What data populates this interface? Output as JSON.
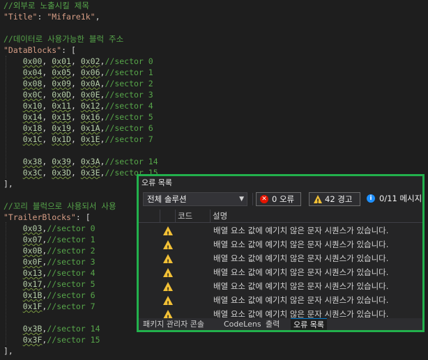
{
  "editor": {
    "lines": [
      {
        "parts": [
          {
            "t": "//외부로 노출시킬 제목",
            "c": "cm"
          }
        ]
      },
      {
        "parts": [
          {
            "t": "\"Title\"",
            "c": "str"
          },
          {
            "t": ": ",
            "c": "pn"
          },
          {
            "t": "\"Mifare1k\"",
            "c": "str"
          },
          {
            "t": ",",
            "c": "pn"
          }
        ]
      },
      {
        "parts": []
      },
      {
        "parts": [
          {
            "t": "//데이터로 사용가능한 블럭 주소",
            "c": "cm"
          }
        ]
      },
      {
        "parts": [
          {
            "t": "\"DataBlocks\"",
            "c": "str"
          },
          {
            "t": ": [",
            "c": "pn"
          }
        ]
      },
      {
        "parts": [
          {
            "t": "    ",
            "c": "pn"
          },
          {
            "t": "0x00",
            "c": "num"
          },
          {
            "t": ", ",
            "c": "pn"
          },
          {
            "t": "0x01",
            "c": "num"
          },
          {
            "t": ", ",
            "c": "pn"
          },
          {
            "t": "0x02",
            "c": "num"
          },
          {
            "t": ",",
            "c": "pn"
          },
          {
            "t": "//sector 0",
            "c": "cm"
          }
        ]
      },
      {
        "parts": [
          {
            "t": "    ",
            "c": "pn"
          },
          {
            "t": "0x04",
            "c": "num"
          },
          {
            "t": ", ",
            "c": "pn"
          },
          {
            "t": "0x05",
            "c": "num"
          },
          {
            "t": ", ",
            "c": "pn"
          },
          {
            "t": "0x06",
            "c": "num"
          },
          {
            "t": ",",
            "c": "pn"
          },
          {
            "t": "//sector 1",
            "c": "cm"
          }
        ]
      },
      {
        "parts": [
          {
            "t": "    ",
            "c": "pn"
          },
          {
            "t": "0x08",
            "c": "num"
          },
          {
            "t": ", ",
            "c": "pn"
          },
          {
            "t": "0x09",
            "c": "num"
          },
          {
            "t": ", ",
            "c": "pn"
          },
          {
            "t": "0x0A",
            "c": "num"
          },
          {
            "t": ",",
            "c": "pn"
          },
          {
            "t": "//sector 2",
            "c": "cm"
          }
        ]
      },
      {
        "parts": [
          {
            "t": "    ",
            "c": "pn"
          },
          {
            "t": "0x0C",
            "c": "num"
          },
          {
            "t": ", ",
            "c": "pn"
          },
          {
            "t": "0x0D",
            "c": "num"
          },
          {
            "t": ", ",
            "c": "pn"
          },
          {
            "t": "0x0E",
            "c": "num"
          },
          {
            "t": ",",
            "c": "pn"
          },
          {
            "t": "//sector 3",
            "c": "cm"
          }
        ]
      },
      {
        "parts": [
          {
            "t": "    ",
            "c": "pn"
          },
          {
            "t": "0x10",
            "c": "num"
          },
          {
            "t": ", ",
            "c": "pn"
          },
          {
            "t": "0x11",
            "c": "num"
          },
          {
            "t": ", ",
            "c": "pn"
          },
          {
            "t": "0x12",
            "c": "num"
          },
          {
            "t": ",",
            "c": "pn"
          },
          {
            "t": "//sector 4",
            "c": "cm"
          }
        ]
      },
      {
        "parts": [
          {
            "t": "    ",
            "c": "pn"
          },
          {
            "t": "0x14",
            "c": "num"
          },
          {
            "t": ", ",
            "c": "pn"
          },
          {
            "t": "0x15",
            "c": "num"
          },
          {
            "t": ", ",
            "c": "pn"
          },
          {
            "t": "0x16",
            "c": "num"
          },
          {
            "t": ",",
            "c": "pn"
          },
          {
            "t": "//sector 5",
            "c": "cm"
          }
        ]
      },
      {
        "parts": [
          {
            "t": "    ",
            "c": "pn"
          },
          {
            "t": "0x18",
            "c": "num"
          },
          {
            "t": ", ",
            "c": "pn"
          },
          {
            "t": "0x19",
            "c": "num"
          },
          {
            "t": ", ",
            "c": "pn"
          },
          {
            "t": "0x1A",
            "c": "num"
          },
          {
            "t": ",",
            "c": "pn"
          },
          {
            "t": "//sector 6",
            "c": "cm"
          }
        ]
      },
      {
        "parts": [
          {
            "t": "    ",
            "c": "pn"
          },
          {
            "t": "0x1C",
            "c": "num"
          },
          {
            "t": ", ",
            "c": "pn"
          },
          {
            "t": "0x1D",
            "c": "num"
          },
          {
            "t": ", ",
            "c": "pn"
          },
          {
            "t": "0x1E",
            "c": "num"
          },
          {
            "t": ",",
            "c": "pn"
          },
          {
            "t": "//sector 7",
            "c": "cm"
          }
        ]
      },
      {
        "parts": []
      },
      {
        "parts": [
          {
            "t": "    ",
            "c": "pn"
          },
          {
            "t": "0x38",
            "c": "num"
          },
          {
            "t": ", ",
            "c": "pn"
          },
          {
            "t": "0x39",
            "c": "num"
          },
          {
            "t": ", ",
            "c": "pn"
          },
          {
            "t": "0x3A",
            "c": "num"
          },
          {
            "t": ",",
            "c": "pn"
          },
          {
            "t": "//sector 14",
            "c": "cm"
          }
        ]
      },
      {
        "parts": [
          {
            "t": "    ",
            "c": "pn"
          },
          {
            "t": "0x3C",
            "c": "num"
          },
          {
            "t": ", ",
            "c": "pn"
          },
          {
            "t": "0x3D",
            "c": "num"
          },
          {
            "t": ", ",
            "c": "pn"
          },
          {
            "t": "0x3E",
            "c": "num"
          },
          {
            "t": ",",
            "c": "pn"
          },
          {
            "t": "//sector 15",
            "c": "cm"
          }
        ]
      },
      {
        "parts": [
          {
            "t": "],",
            "c": "pn"
          }
        ]
      },
      {
        "parts": []
      },
      {
        "parts": [
          {
            "t": "//꼬리 블럭으로 사용되서 사용",
            "c": "cm"
          }
        ]
      },
      {
        "parts": [
          {
            "t": "\"TrailerBlocks\"",
            "c": "str"
          },
          {
            "t": ": [",
            "c": "pn"
          }
        ]
      },
      {
        "parts": [
          {
            "t": "    ",
            "c": "pn"
          },
          {
            "t": "0x03",
            "c": "num"
          },
          {
            "t": ",",
            "c": "pn"
          },
          {
            "t": "//sector 0",
            "c": "cm"
          }
        ]
      },
      {
        "parts": [
          {
            "t": "    ",
            "c": "pn"
          },
          {
            "t": "0x07",
            "c": "num"
          },
          {
            "t": ",",
            "c": "pn"
          },
          {
            "t": "//sector 1",
            "c": "cm"
          }
        ]
      },
      {
        "parts": [
          {
            "t": "    ",
            "c": "pn"
          },
          {
            "t": "0x0B",
            "c": "num"
          },
          {
            "t": ",",
            "c": "pn"
          },
          {
            "t": "//sector 2",
            "c": "cm"
          }
        ]
      },
      {
        "parts": [
          {
            "t": "    ",
            "c": "pn"
          },
          {
            "t": "0x0F",
            "c": "num"
          },
          {
            "t": ",",
            "c": "pn"
          },
          {
            "t": "//sector 3",
            "c": "cm"
          }
        ]
      },
      {
        "parts": [
          {
            "t": "    ",
            "c": "pn"
          },
          {
            "t": "0x13",
            "c": "num"
          },
          {
            "t": ",",
            "c": "pn"
          },
          {
            "t": "//sector 4",
            "c": "cm"
          }
        ]
      },
      {
        "parts": [
          {
            "t": "    ",
            "c": "pn"
          },
          {
            "t": "0x17",
            "c": "num"
          },
          {
            "t": ",",
            "c": "pn"
          },
          {
            "t": "//sector 5",
            "c": "cm"
          }
        ]
      },
      {
        "parts": [
          {
            "t": "    ",
            "c": "pn"
          },
          {
            "t": "0x1B",
            "c": "num"
          },
          {
            "t": ",",
            "c": "pn"
          },
          {
            "t": "//sector 6",
            "c": "cm"
          }
        ]
      },
      {
        "parts": [
          {
            "t": "    ",
            "c": "pn"
          },
          {
            "t": "0x1F",
            "c": "num"
          },
          {
            "t": ",",
            "c": "pn"
          },
          {
            "t": "//sector 7",
            "c": "cm"
          }
        ]
      },
      {
        "parts": []
      },
      {
        "parts": [
          {
            "t": "    ",
            "c": "pn"
          },
          {
            "t": "0x3B",
            "c": "num"
          },
          {
            "t": ",",
            "c": "pn"
          },
          {
            "t": "//sector 14",
            "c": "cm"
          }
        ]
      },
      {
        "parts": [
          {
            "t": "    ",
            "c": "pn"
          },
          {
            "t": "0x3F",
            "c": "num"
          },
          {
            "t": ",",
            "c": "pn"
          },
          {
            "t": "//sector 15",
            "c": "cm"
          }
        ]
      },
      {
        "parts": [
          {
            "t": "],",
            "c": "pn"
          }
        ]
      }
    ]
  },
  "error_list": {
    "title": "오류 목록",
    "scope": "전체 솔루션",
    "errors_label": "0 오류",
    "warnings_label": "42 경고",
    "messages_label": "0/11 메시지",
    "columns": {
      "code": "코드",
      "description": "설명"
    },
    "rows": [
      {
        "description": "배열 요소 값에 예기치 않은 문자 시퀀스가 있습니다."
      },
      {
        "description": "배열 요소 값에 예기치 않은 문자 시퀀스가 있습니다."
      },
      {
        "description": "배열 요소 값에 예기치 않은 문자 시퀀스가 있습니다."
      },
      {
        "description": "배열 요소 값에 예기치 않은 문자 시퀀스가 있습니다."
      },
      {
        "description": "배열 요소 값에 예기치 않은 문자 시퀀스가 있습니다."
      },
      {
        "description": "배열 요소 값에 예기치 않은 문자 시퀀스가 있습니다."
      },
      {
        "description": "배열 요소 값에 예기치 않은 문자 시퀀스가 있습니다."
      }
    ],
    "tabs": [
      {
        "label": "패키지 관리자 콘솔"
      },
      {
        "label": "CodeLens"
      },
      {
        "label": "출력"
      },
      {
        "label": "오류 목록",
        "active": true
      }
    ]
  },
  "colors": {
    "highlight_border": "#22b14c",
    "warning": "#f2c036",
    "error": "#e51400"
  }
}
